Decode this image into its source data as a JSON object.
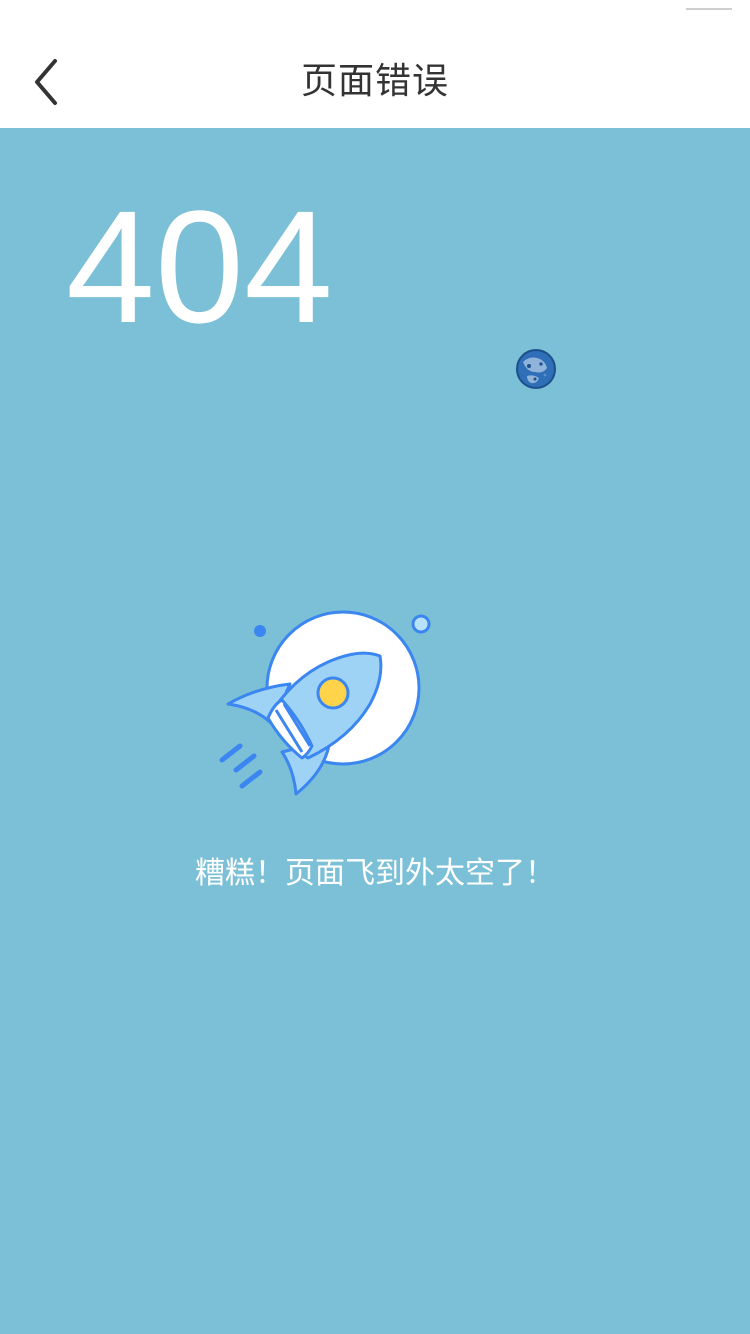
{
  "nav": {
    "title": "页面错误",
    "back_icon": "chevron-left-icon"
  },
  "error": {
    "code": "404",
    "message": "糟糕！页面飞到外太空了！"
  },
  "illustration": {
    "planet_icon": "planet-icon",
    "rocket_icon": "rocket-icon"
  },
  "colors": {
    "background": "#7bc0d6",
    "nav_background": "#ffffff",
    "title_text": "#333333",
    "accent_blue": "#3b86f0",
    "rocket_fill": "#9fd3f5",
    "window_yellow": "#ffd44a"
  }
}
